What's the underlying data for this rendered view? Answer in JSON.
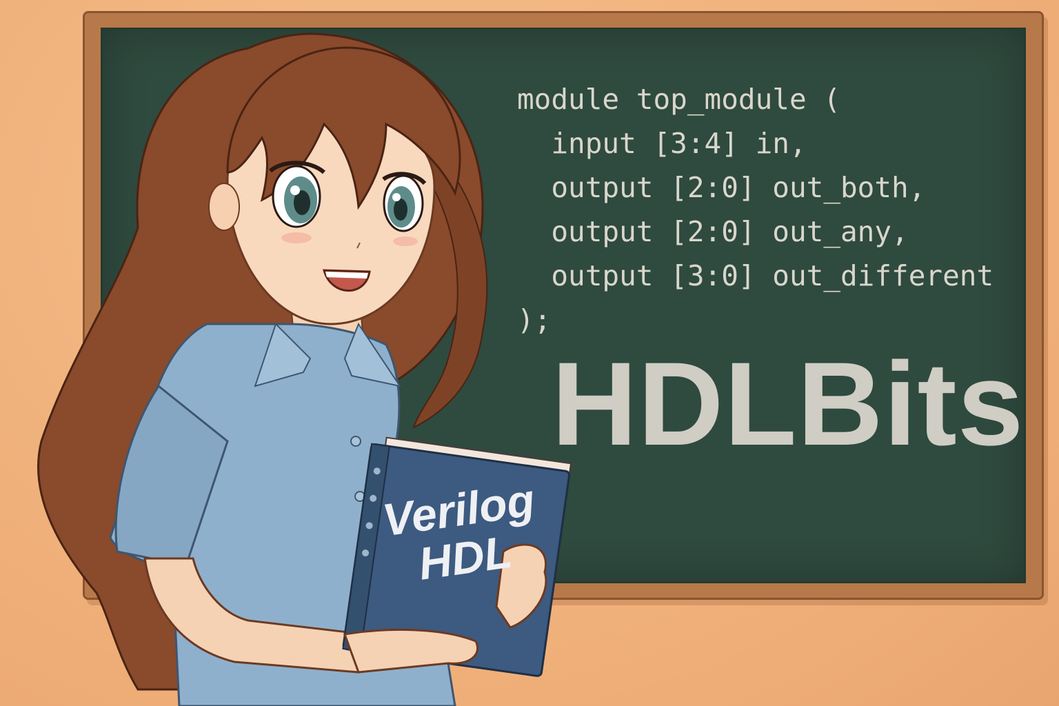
{
  "chalkboard": {
    "code_lines": [
      "module top_module (",
      "  input [3:4] in,",
      "  output [2:0] out_both,",
      "  output [2:0] out_any,",
      "  output [3:0] out_different",
      ");"
    ],
    "brand": "HDLBits"
  },
  "book": {
    "title_lines": [
      "Verilog",
      "HDL"
    ],
    "cover_color": "#3d5a80"
  },
  "colors": {
    "wall": "#f2b47e",
    "board": "#2f4a3e",
    "frame": "#b8794a",
    "chalk": "#d9d6cc",
    "hair": "#8a4a2c",
    "shirt": "#8fb0cc"
  }
}
